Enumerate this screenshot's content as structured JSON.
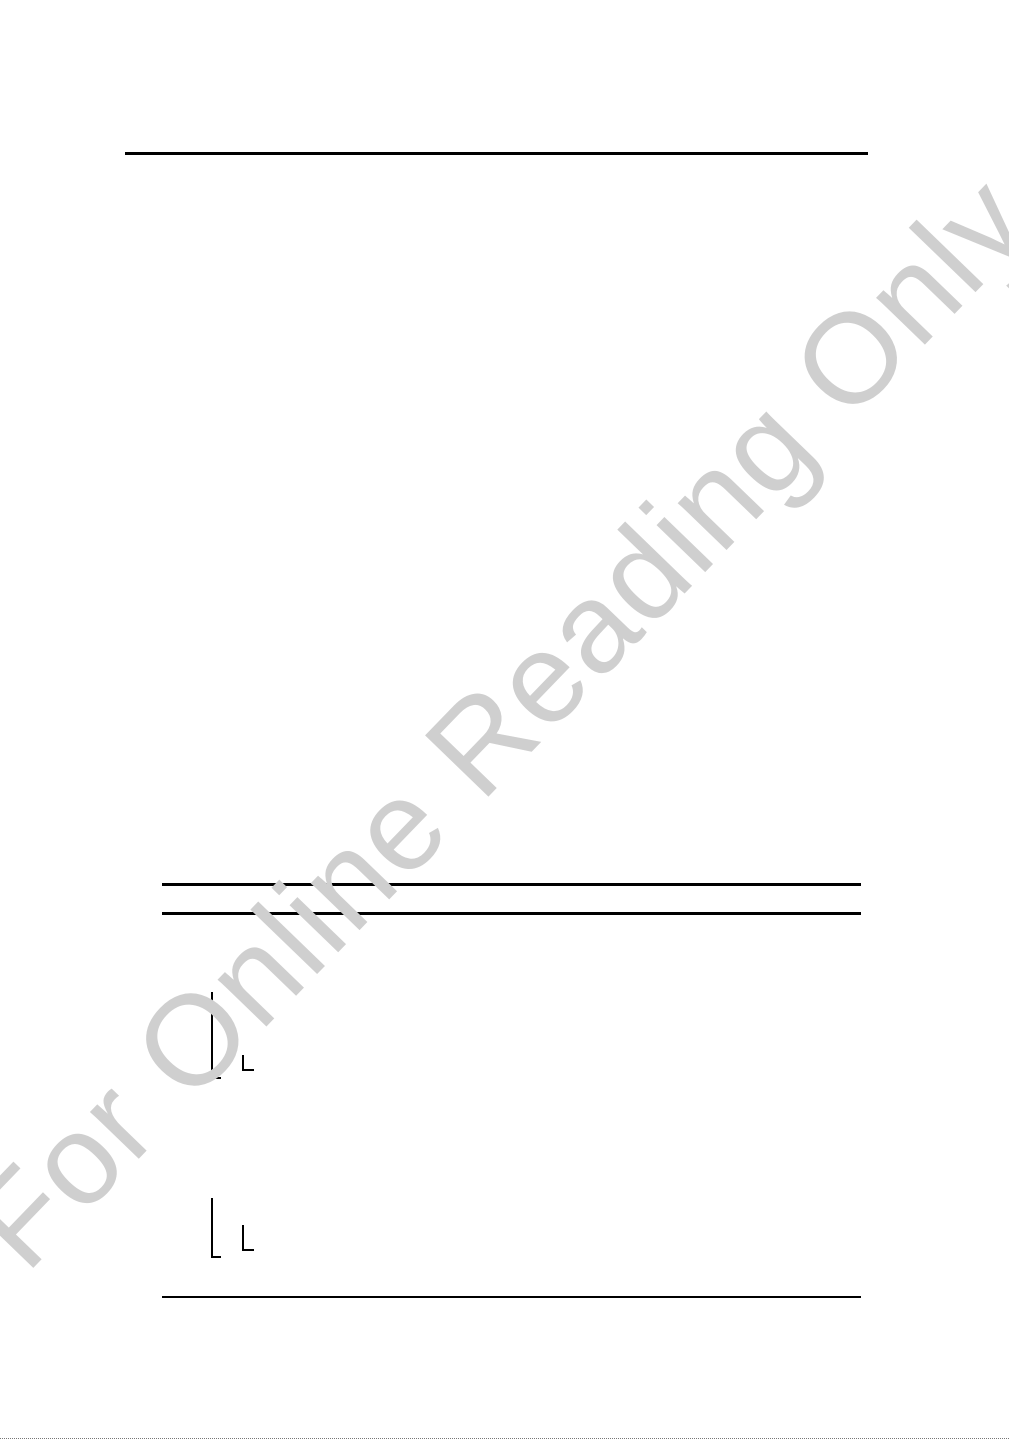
{
  "watermark": {
    "text": "For Online Reading Only",
    "color": "#cfcfcf"
  }
}
